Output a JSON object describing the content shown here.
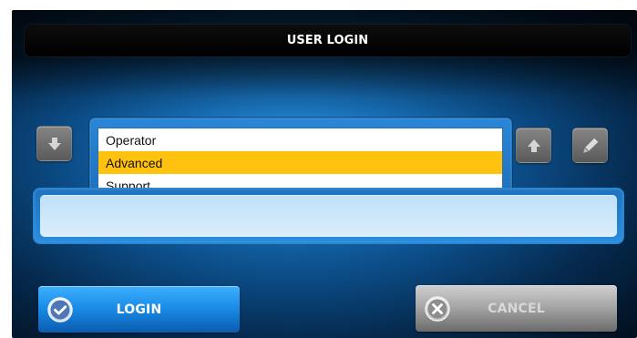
{
  "window": {
    "title": "USER LOGIN"
  },
  "controls": {
    "down_icon": "arrow-down-icon",
    "up_icon": "arrow-up-icon",
    "edit_icon": "pencil-icon"
  },
  "user_level_dropdown": {
    "selected_value": "Advanced",
    "options": [
      "Operator",
      "Advanced",
      "Support"
    ]
  },
  "password_field": {
    "value": ""
  },
  "actions": {
    "login_label": "LOGIN",
    "cancel_label": "CANCEL",
    "login_icon": "check-circle-icon",
    "cancel_icon": "close-circle-icon"
  },
  "colors": {
    "selected_option": "#ffc20e",
    "login_button": "#1a8be6",
    "cancel_button": "#a4a4a4",
    "panel_blue": "#176fb7"
  }
}
